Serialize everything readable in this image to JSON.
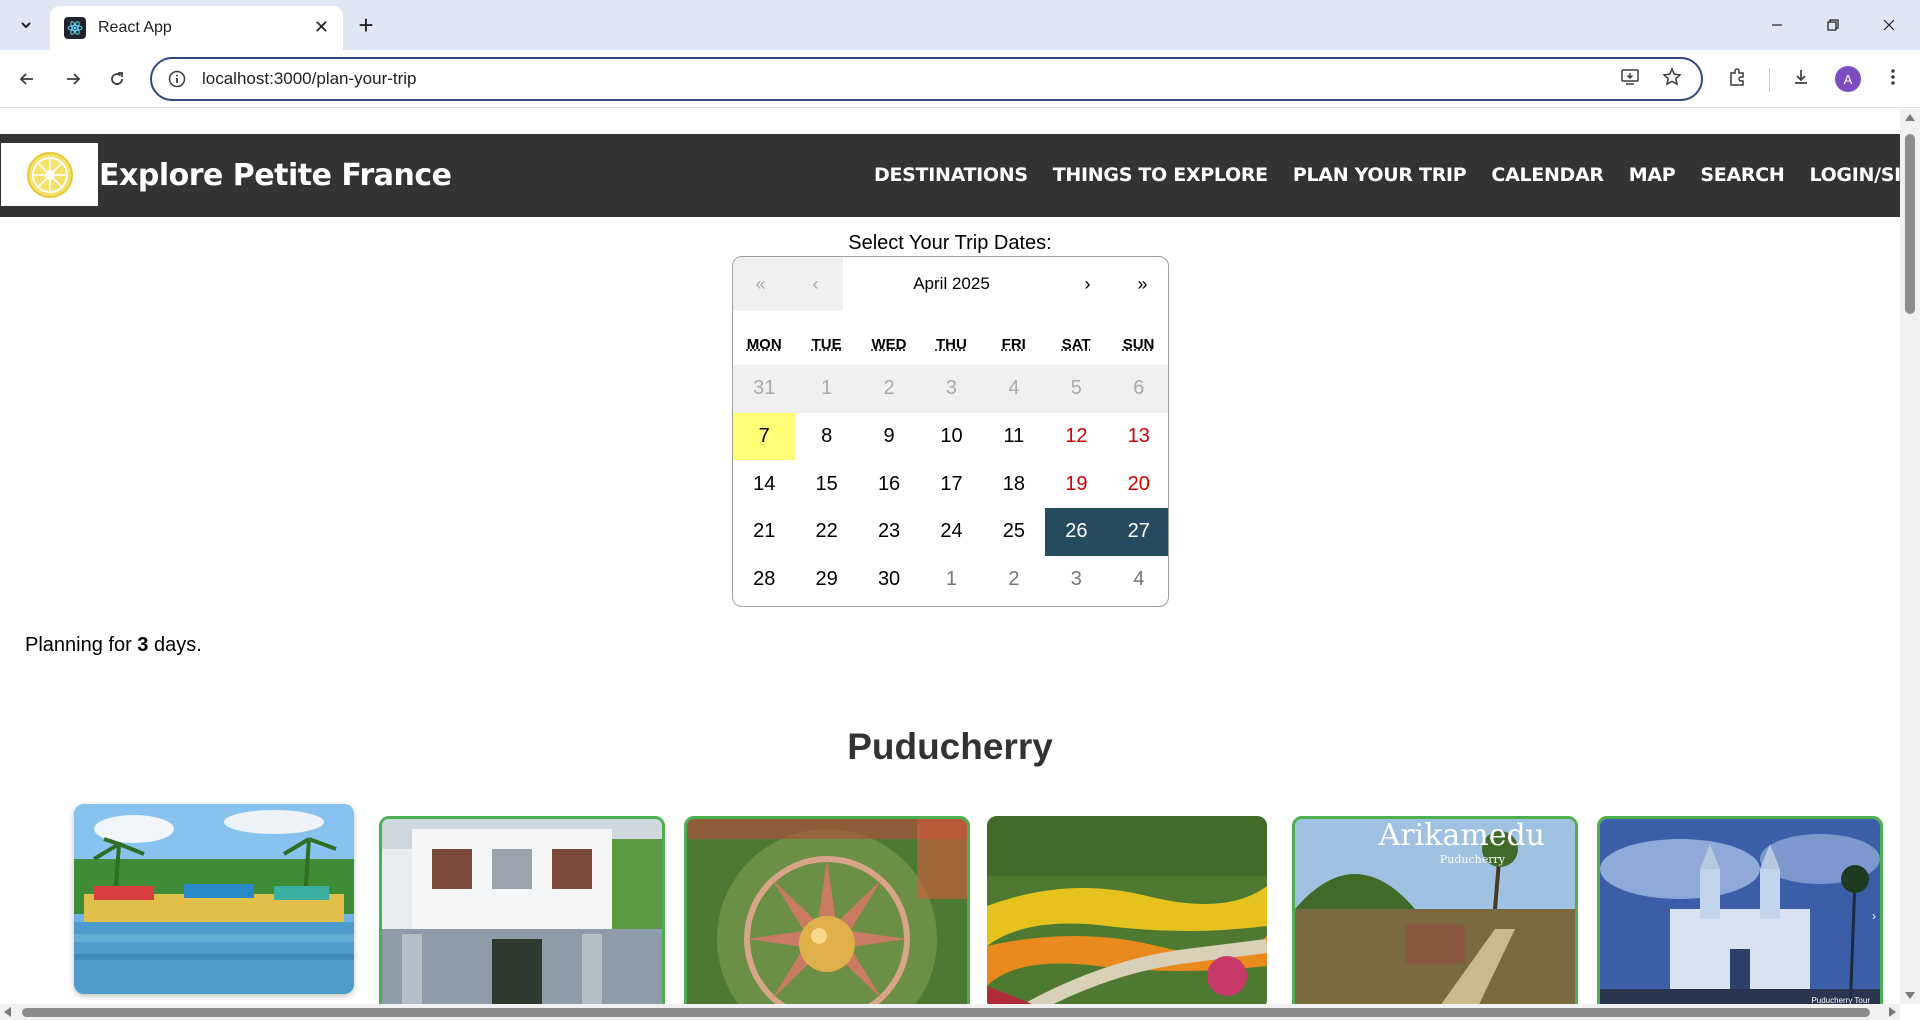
{
  "browser": {
    "tab_title": "React App",
    "url": "localhost:3000/plan-your-trip",
    "avatar_letter": "A"
  },
  "site": {
    "title": "Explore Petite France",
    "nav": [
      "DESTINATIONS",
      "THINGS TO EXPLORE",
      "PLAN YOUR TRIP",
      "CALENDAR",
      "MAP",
      "SEARCH",
      "LOGIN/SIGN UP"
    ]
  },
  "trip": {
    "select_label": "Select Your Trip Dates:",
    "planning_prefix": "Planning for ",
    "days_count": "3",
    "planning_suffix": " days."
  },
  "calendar": {
    "month_label": "April 2025",
    "nav": {
      "prev2": "«",
      "prev": "‹",
      "next": "›",
      "next2": "»"
    },
    "weekdays": [
      "MON",
      "TUE",
      "WED",
      "THU",
      "FRI",
      "SAT",
      "SUN"
    ],
    "days": [
      {
        "d": "31",
        "t": "prev"
      },
      {
        "d": "1",
        "t": "prev"
      },
      {
        "d": "2",
        "t": "prev"
      },
      {
        "d": "3",
        "t": "prev"
      },
      {
        "d": "4",
        "t": "prev"
      },
      {
        "d": "5",
        "t": "prev"
      },
      {
        "d": "6",
        "t": "prev"
      },
      {
        "d": "7",
        "t": "today"
      },
      {
        "d": "8",
        "t": ""
      },
      {
        "d": "9",
        "t": ""
      },
      {
        "d": "10",
        "t": ""
      },
      {
        "d": "11",
        "t": ""
      },
      {
        "d": "12",
        "t": "weekend"
      },
      {
        "d": "13",
        "t": "weekend"
      },
      {
        "d": "14",
        "t": ""
      },
      {
        "d": "15",
        "t": ""
      },
      {
        "d": "16",
        "t": ""
      },
      {
        "d": "17",
        "t": ""
      },
      {
        "d": "18",
        "t": ""
      },
      {
        "d": "19",
        "t": "weekend"
      },
      {
        "d": "20",
        "t": "weekend"
      },
      {
        "d": "21",
        "t": ""
      },
      {
        "d": "22",
        "t": ""
      },
      {
        "d": "23",
        "t": ""
      },
      {
        "d": "24",
        "t": ""
      },
      {
        "d": "25",
        "t": ""
      },
      {
        "d": "26",
        "t": "sel"
      },
      {
        "d": "27",
        "t": "sel"
      },
      {
        "d": "28",
        "t": ""
      },
      {
        "d": "29",
        "t": ""
      },
      {
        "d": "30",
        "t": ""
      },
      {
        "d": "1",
        "t": "next"
      },
      {
        "d": "2",
        "t": "next"
      },
      {
        "d": "3",
        "t": "next"
      },
      {
        "d": "4",
        "t": "next"
      }
    ],
    "colors": {
      "selected": "#264a5f",
      "today": "#ffff76",
      "weekend": "#d10000"
    }
  },
  "region": {
    "title": "Puducherry",
    "cards": [
      {
        "name": "backwaters-boats",
        "highlighted": false
      },
      {
        "name": "white-heritage-house",
        "highlighted": true
      },
      {
        "name": "golden-dome-aerial",
        "highlighted": true
      },
      {
        "name": "flower-garden",
        "highlighted": false
      },
      {
        "name": "arikamedu",
        "highlighted": true,
        "overlay_title": "Arikamedu",
        "overlay_subtitle": "Puducherry"
      },
      {
        "name": "church",
        "highlighted": true,
        "overlay_small": "Puducherry Tour"
      }
    ]
  }
}
